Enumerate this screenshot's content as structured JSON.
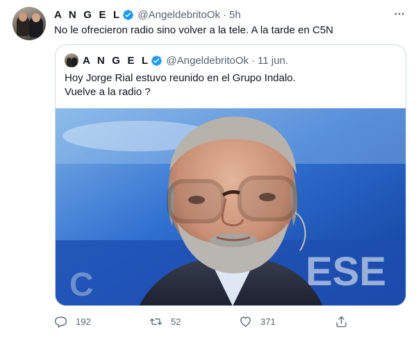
{
  "tweet": {
    "author": {
      "name": "A N G E L",
      "handle": "@AngeldebritoOk",
      "time": "5h",
      "separator": "·"
    },
    "text": "No le ofrecieron radio sino volver a la tele. A la tarde en C5N",
    "more_icon": "ellipsis-icon"
  },
  "quoted_tweet": {
    "author": {
      "name": "A N G E L",
      "handle": "@AngeldebritoOk",
      "time": "11 jun.",
      "separator": "·"
    },
    "lines": [
      "Hoy Jorge Rial estuvo reunido en el Grupo Indalo.",
      "Vuelve a la radio ?"
    ],
    "photo_description_icon": "tv-studio-portrait"
  },
  "actions": {
    "reply": {
      "icon": "reply-icon",
      "count": "192"
    },
    "retweet": {
      "icon": "retweet-icon",
      "count": "52"
    },
    "like": {
      "icon": "heart-icon",
      "count": "371"
    },
    "share": {
      "icon": "share-icon"
    }
  },
  "colors": {
    "text": "#0f1419",
    "secondary": "#536471",
    "verified": "#1d9bf0",
    "border": "#cfd9de"
  }
}
